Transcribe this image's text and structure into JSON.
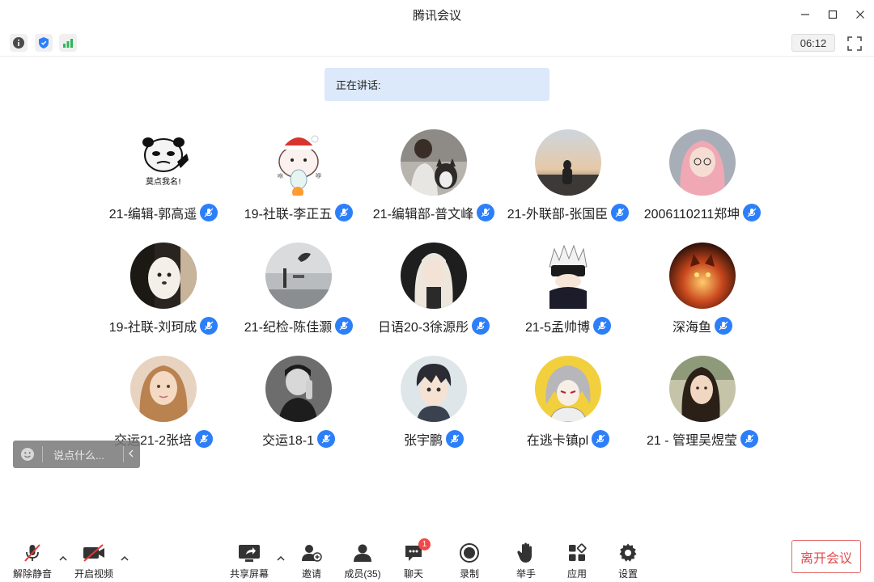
{
  "window": {
    "title": "腾讯会议"
  },
  "infobar": {
    "timer": "06:12"
  },
  "speaking": {
    "label": "正在讲话:"
  },
  "participants": [
    {
      "name": "21-编辑-郭高遥",
      "avatar": "panda-meme",
      "avatar_caption": "莫点我名!"
    },
    {
      "name": "19-社联-李正五",
      "avatar": "bear-christmas"
    },
    {
      "name": "21-编辑部-普文峰",
      "avatar": "person-with-dog"
    },
    {
      "name": "21-外联部-张国臣",
      "avatar": "sunset-silhouette"
    },
    {
      "name": "2006110211郑坤",
      "avatar": "pink-hair-girl"
    },
    {
      "name": "19-社联-刘珂成",
      "avatar": "white-puppy"
    },
    {
      "name": "21-纪检-陈佳灏",
      "avatar": "lake-scene"
    },
    {
      "name": "日语20-3徐源彤",
      "avatar": "blonde-girl"
    },
    {
      "name": "21-5孟帅博",
      "avatar": "anime-white-hair"
    },
    {
      "name": "深海鱼",
      "avatar": "fire-cat"
    },
    {
      "name": "交运21-2张培",
      "avatar": "girl-portrait"
    },
    {
      "name": "交运18-1",
      "avatar": "bw-man"
    },
    {
      "name": "张宇鹏",
      "avatar": "anime-boy"
    },
    {
      "name": "在逃卡镇pl",
      "avatar": "anime-gray-hair"
    },
    {
      "name": "21 - 管理吴煜莹",
      "avatar": "girl-outdoor"
    }
  ],
  "chat": {
    "placeholder": "说点什么..."
  },
  "toolbar": {
    "unmute": "解除静音",
    "video": "开启视频",
    "share": "共享屏幕",
    "invite": "邀请",
    "members": "成员(35)",
    "chat": "聊天",
    "chat_badge": "1",
    "record": "录制",
    "raise_hand": "举手",
    "apps": "应用",
    "settings": "设置",
    "leave": "离开会议"
  },
  "colors": {
    "accent": "#2d7ff9",
    "danger": "#e04b4b",
    "banner": "#dce9fb"
  }
}
